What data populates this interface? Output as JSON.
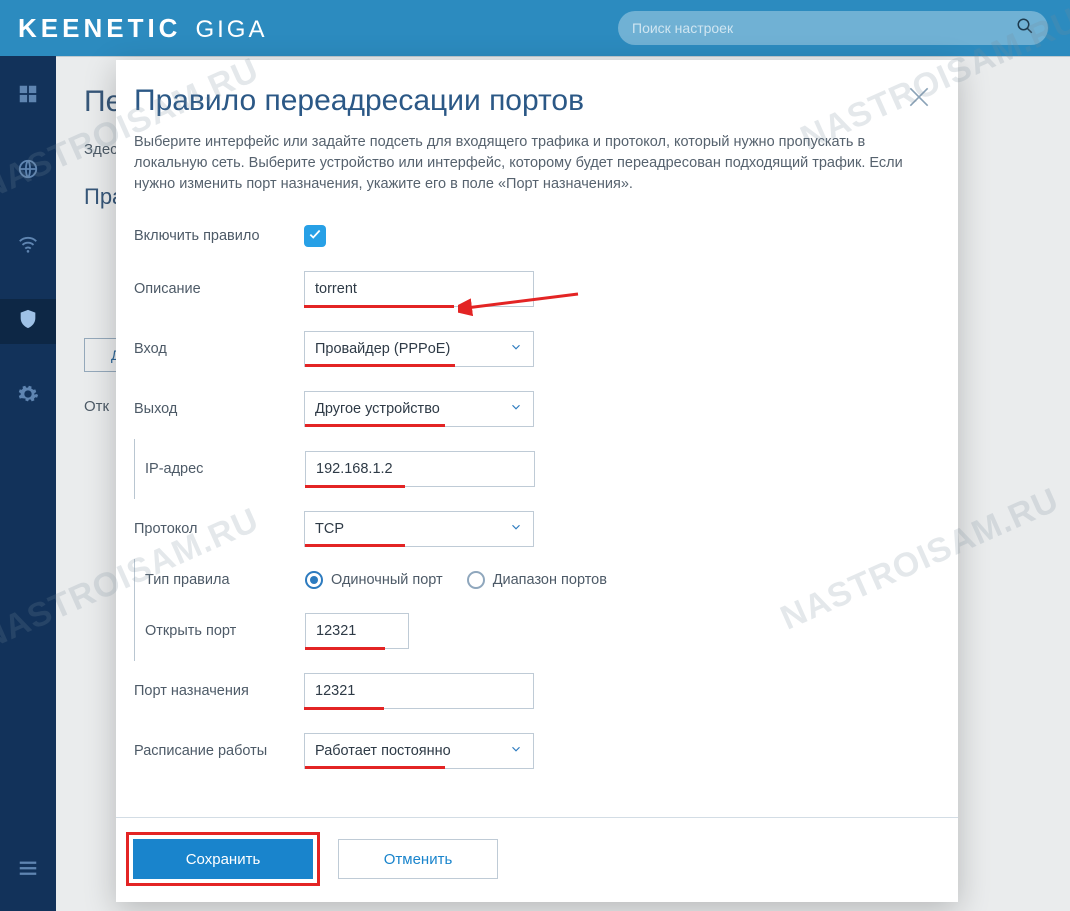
{
  "brand": {
    "main": "KEENETIC",
    "sub": "GIGA"
  },
  "search": {
    "placeholder": "Поиск настроек"
  },
  "page": {
    "title_partial": "Пе",
    "desc_partial": "Здес",
    "section_partial": "Пра",
    "add_btn_partial": "Д",
    "open_partial": "Отк"
  },
  "modal": {
    "title": "Правило переадресации портов",
    "desc": "Выберите интерфейс или задайте подсеть для входящего трафика и протокол, который нужно пропускать в локальную сеть. Выберите устройство или интерфейс, которому будет переадресован подходящий трафик. Если нужно изменить порт назначения, укажите его в поле «Порт назначения».",
    "labels": {
      "enable": "Включить правило",
      "desc": "Описание",
      "input": "Вход",
      "output": "Выход",
      "ip": "IP-адрес",
      "proto": "Протокол",
      "ruletype": "Тип правила",
      "openport": "Открыть порт",
      "dstport": "Порт назначения",
      "schedule": "Расписание работы"
    },
    "values": {
      "desc": "torrent",
      "input": "Провайдер (PPPoE)",
      "output": "Другое устройство",
      "ip": "192.168.1.2",
      "proto": "TCP",
      "openport": "12321",
      "dstport": "12321",
      "schedule": "Работает постоянно"
    },
    "radios": {
      "single": "Одиночный порт",
      "range": "Диапазон портов"
    },
    "buttons": {
      "save": "Сохранить",
      "cancel": "Отменить"
    }
  },
  "watermark": "NASTROISAM.RU"
}
